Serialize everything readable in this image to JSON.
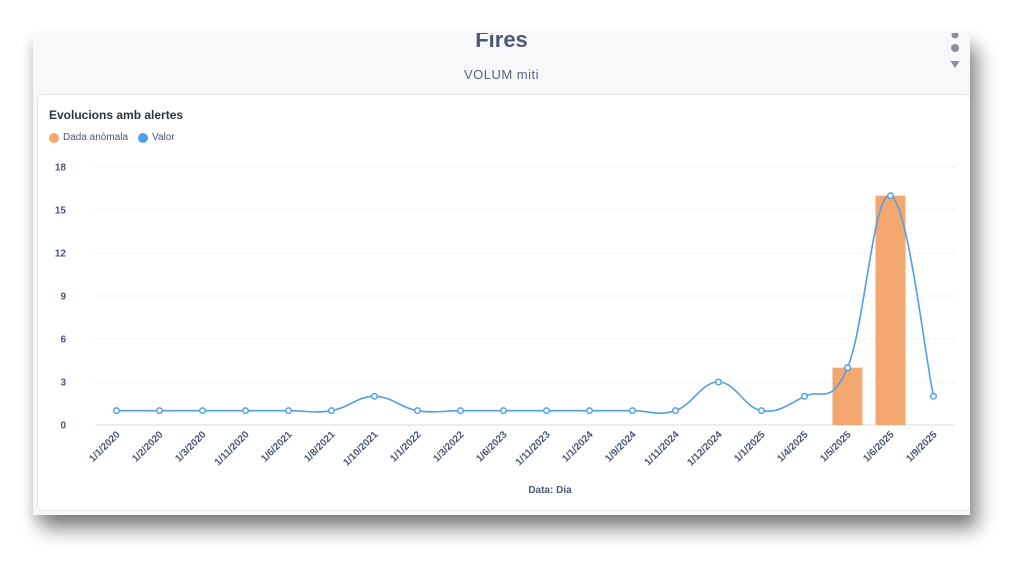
{
  "header": {
    "title": "Fires",
    "subtitle": "VOLUM miti"
  },
  "card": {
    "title": "Evolucions amb alertes"
  },
  "colors": {
    "anomaly": "#f2a86f",
    "value": "#509ee3"
  },
  "chart_data": {
    "type": "bar",
    "title": "Evolucions amb alertes",
    "xlabel": "Data: Dia",
    "ylabel": "",
    "ylim": [
      0,
      18
    ],
    "yticks": [
      0,
      3,
      6,
      9,
      12,
      15,
      18
    ],
    "grid": true,
    "legend_position": "top-left",
    "categories": [
      "1/1/2020",
      "1/2/2020",
      "1/3/2020",
      "1/11/2020",
      "1/6/2021",
      "1/8/2021",
      "1/10/2021",
      "1/1/2022",
      "1/3/2022",
      "1/6/2023",
      "1/11/2023",
      "1/1/2024",
      "1/9/2024",
      "1/11/2024",
      "1/12/2024",
      "1/1/2025",
      "1/4/2025",
      "1/5/2025",
      "1/6/2025",
      "1/9/2025"
    ],
    "series": [
      {
        "name": "Dada anòmala",
        "type": "bar",
        "color": "#f2a86f",
        "values": [
          null,
          null,
          null,
          null,
          null,
          null,
          null,
          null,
          null,
          null,
          null,
          null,
          null,
          null,
          null,
          null,
          null,
          4,
          16,
          null
        ]
      },
      {
        "name": "Valor",
        "type": "line",
        "color": "#509ee3",
        "values": [
          1,
          1,
          1,
          1,
          1,
          1,
          2,
          1,
          1,
          1,
          1,
          1,
          1,
          1,
          3,
          1,
          2,
          4,
          16,
          2
        ]
      }
    ]
  }
}
